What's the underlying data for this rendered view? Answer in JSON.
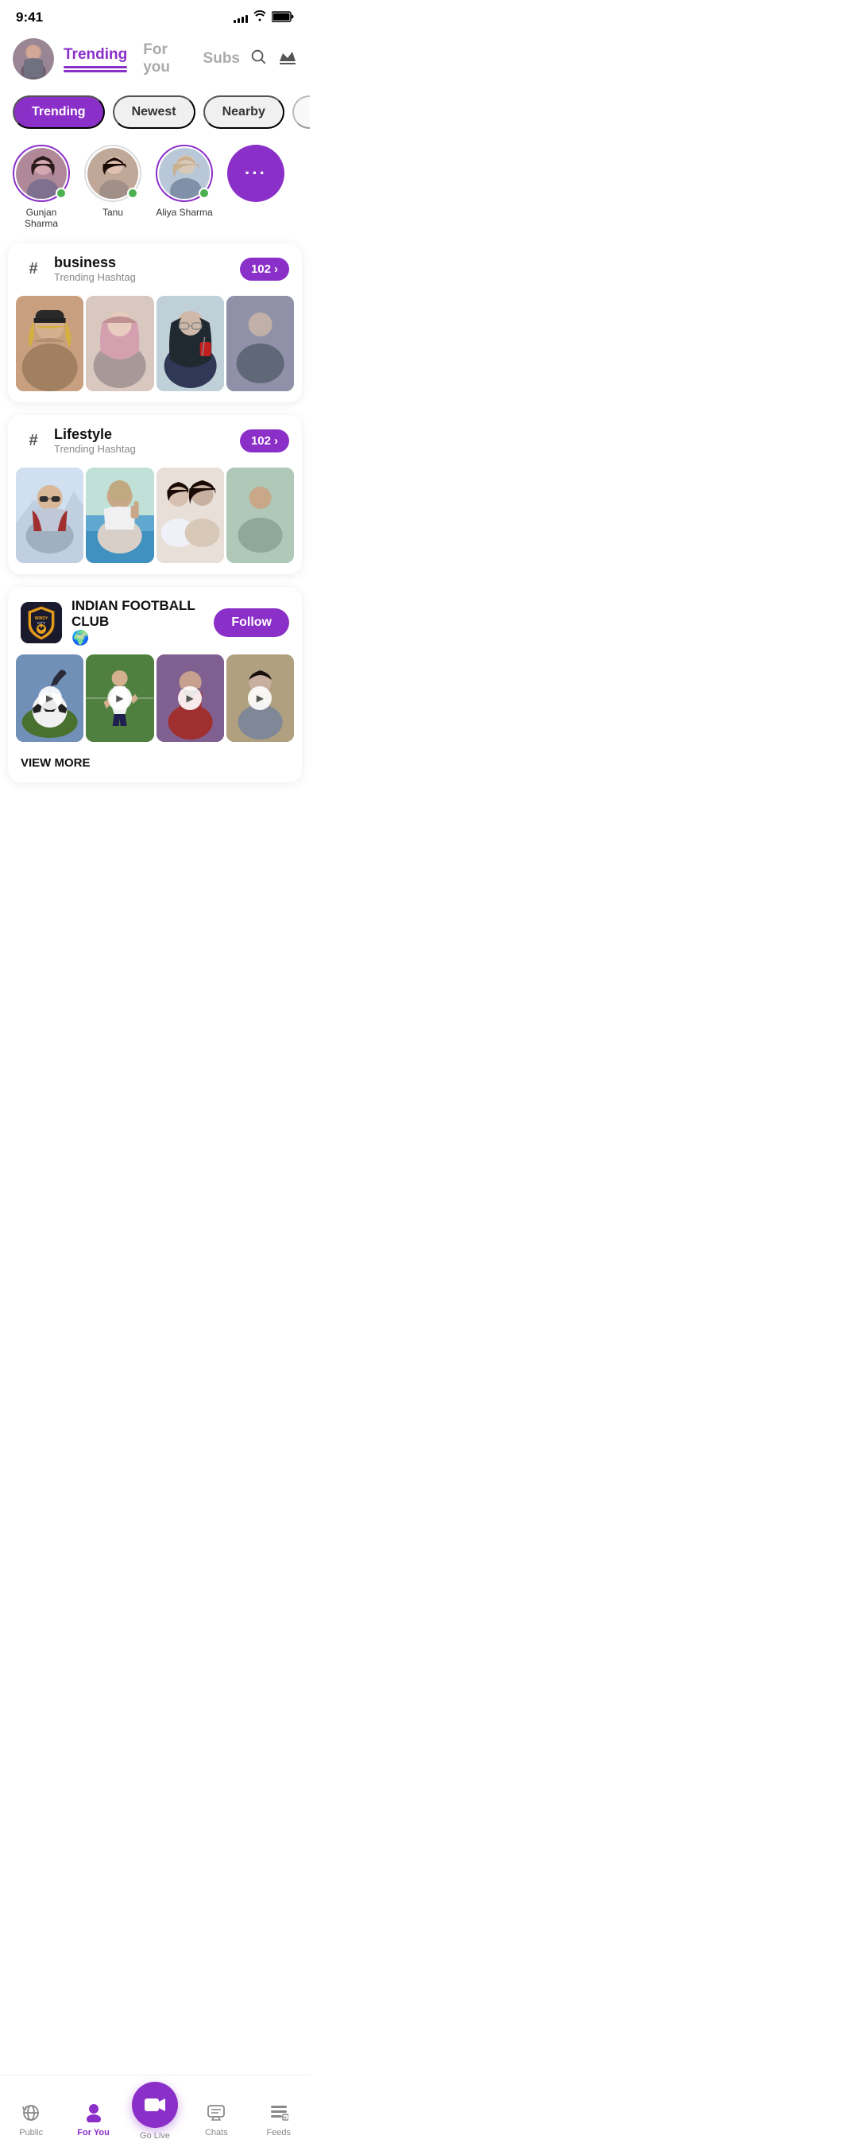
{
  "statusBar": {
    "time": "9:41",
    "signalBars": [
      4,
      6,
      8,
      10,
      12
    ],
    "batteryLevel": "full"
  },
  "header": {
    "tabs": [
      {
        "id": "trending",
        "label": "Trending",
        "active": true
      },
      {
        "id": "for-you",
        "label": "For you",
        "active": false
      },
      {
        "id": "subs",
        "label": "Subs",
        "active": false
      }
    ],
    "searchIcon": "🔍",
    "crownIcon": "👑"
  },
  "filters": [
    {
      "id": "trending",
      "label": "Trending",
      "active": true
    },
    {
      "id": "newest",
      "label": "Newest",
      "active": false
    },
    {
      "id": "nearby",
      "label": "Nearby",
      "active": false
    }
  ],
  "stories": [
    {
      "id": "gunjan",
      "name": "Gunjan Sharma",
      "online": true,
      "hasRing": true
    },
    {
      "id": "tanu",
      "name": "Tanu",
      "online": true,
      "hasRing": false
    },
    {
      "id": "aliya",
      "name": "Aliya Sharma",
      "online": true,
      "hasRing": true
    },
    {
      "id": "more",
      "name": "",
      "isMore": true
    }
  ],
  "hashtags": [
    {
      "id": "business",
      "symbol": "#",
      "title": "business",
      "subtitle": "Trending Hashtag",
      "count": "102",
      "photos": [
        "woman1",
        "woman2",
        "woman3",
        "partial"
      ]
    },
    {
      "id": "lifestyle",
      "symbol": "#",
      "title": "Lifestyle",
      "subtitle": "Trending Hashtag",
      "count": "102",
      "photos": [
        "man1",
        "man2",
        "group",
        "partial2"
      ]
    }
  ],
  "club": {
    "logoText": "WINDY city RAMPAGE",
    "name": "INDIAN FOOTBALL CLUB",
    "type": "🌍",
    "followLabel": "Follow",
    "viewMoreLabel": "VIEW MORE",
    "videos": [
      "video1",
      "video2",
      "video3",
      "video4"
    ]
  },
  "bottomNav": [
    {
      "id": "public",
      "label": "Public",
      "icon": "📡",
      "active": false
    },
    {
      "id": "for-you",
      "label": "For You",
      "icon": "👤",
      "active": true
    },
    {
      "id": "go-live",
      "label": "Go Live",
      "icon": "🎥",
      "isCenter": true
    },
    {
      "id": "chats",
      "label": "Chats",
      "icon": "💬",
      "active": false
    },
    {
      "id": "feeds",
      "label": "Feeds",
      "icon": "📋",
      "active": false
    }
  ]
}
